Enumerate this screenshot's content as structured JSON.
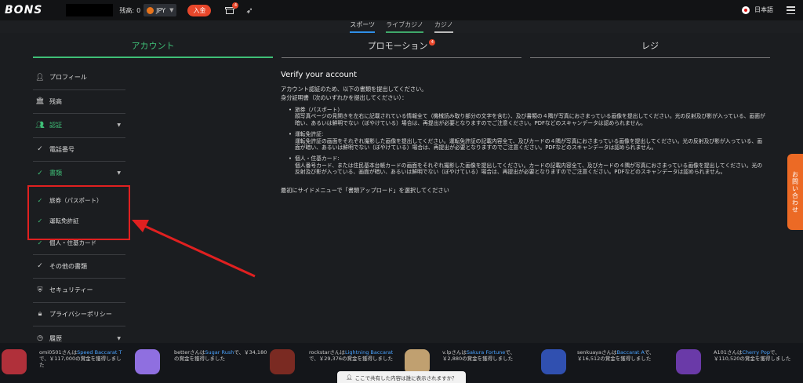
{
  "header": {
    "logo": "BONS",
    "balance_label": "残高:",
    "balance_value": "0",
    "currency": "JPY",
    "deposit_label": "入金",
    "gift_badge": "4",
    "language": "日本語"
  },
  "subnav": {
    "items": [
      "スポーツ",
      "ライブカジノ",
      "カジノ"
    ]
  },
  "tabs": [
    {
      "label": "アカウント"
    },
    {
      "label": "プロモーション",
      "badge": "4"
    },
    {
      "label": "レジ"
    }
  ],
  "sidebar": {
    "items": [
      {
        "label": "プロフィール",
        "icon": "user-icon"
      },
      {
        "label": "残高",
        "icon": "bank-icon"
      },
      {
        "label": "認証",
        "icon": "users-icon"
      },
      {
        "label": "電話番号",
        "icon": "check-icon"
      },
      {
        "label": "書類",
        "icon": "check-icon"
      },
      {
        "label": "旅券（パスポート）",
        "icon": "check-icon"
      },
      {
        "label": "運転免許証",
        "icon": "check-icon"
      },
      {
        "label": "個人・住基カード",
        "icon": "check-icon"
      },
      {
        "label": "その他の書類",
        "icon": "check-icon"
      },
      {
        "label": "セキュリティー",
        "icon": "shield-icon"
      },
      {
        "label": "プライバシーポリシー",
        "icon": "lock-icon"
      },
      {
        "label": "履歴",
        "icon": "clock-icon"
      }
    ]
  },
  "content": {
    "title": "Verify your account",
    "intro": "アカウント認証のため、以下の書類を提出してください。",
    "id_heading": "身分証明書（次のいずれかを提出してください）：",
    "list": [
      {
        "heading": "旅券（パスポート）",
        "text": "顔写真ページの見開きを左右に記載されている情報全て（機械読み取り部分の文字を含む）、及び書類の４隅が写真におさまっている画像を提出してください。光の反射及び影が入っている、画面が暗い、あるいは鮮明でない（ぼやけている）場合は、再提出が必要となりますのでご注意ください。PDFなどのスキャンデータは認められません。"
      },
      {
        "heading": "運転免許証:",
        "text": "運転免許証の画面をそれぞれ撮影した画像を提出してください。運転免許証の記載内容全て、及びカードの４隅が写真におさまっている画像を提出してください。光の反射及び影が入っている、画面が暗い、あるいは鮮明でない（ぼやけている）場合は、再提出が必要となりますのでご注意ください。PDFなどのスキャンデータは認められません。"
      },
      {
        "heading": "個人・住基カード:",
        "text": "個人番号カード、または住民基本台帳カードの画面をそれぞれ撮影した画像を提出してください。カードの記載内容全て、及びカードの４隅が写真におさまっている画像を提出してください。光の反射及び影が入っている、画面が暗い、あるいは鮮明でない（ぼやけている）場合は、再提出が必要となりますのでご注意ください。PDFなどのスキャンデータは認められません。"
      }
    ],
    "final": "最初にサイドメニューで「書類アップロード」を選択してください"
  },
  "contact_label": "お問い合わせ",
  "winners": [
    {
      "user": "omi0501さんは",
      "game": "Speed Baccarat T",
      "rest": "で、￥117,000の賞金を獲得しました",
      "color": "#b0303a"
    },
    {
      "user": "betterさんは",
      "game": "Sugar Rush",
      "rest": "で、￥34,180の賞金を獲得しました",
      "color": "#8f6fe0"
    },
    {
      "user": "rockstarさんは",
      "game": "Lightning Baccarat",
      "rest": "で、￥29,376の賞金を獲得しました",
      "color": "#7a2a22"
    },
    {
      "user": "v.lpさんは",
      "game": "Sakura Fortune",
      "rest": "で、￥2,880の賞金を獲得しました",
      "color": "#c0a070"
    },
    {
      "user": "senkuayaさんは",
      "game": "Baccarat A",
      "rest": "で、￥16,512の賞金を獲得しました",
      "color": "#3050b0"
    },
    {
      "user": "A101さんは",
      "game": "Cherry Pop",
      "rest": "で、￥110,520の賞金を獲得しました",
      "color": "#6a3aa8"
    }
  ],
  "popup": "ここで共有した内容は誰に表示されますか？"
}
